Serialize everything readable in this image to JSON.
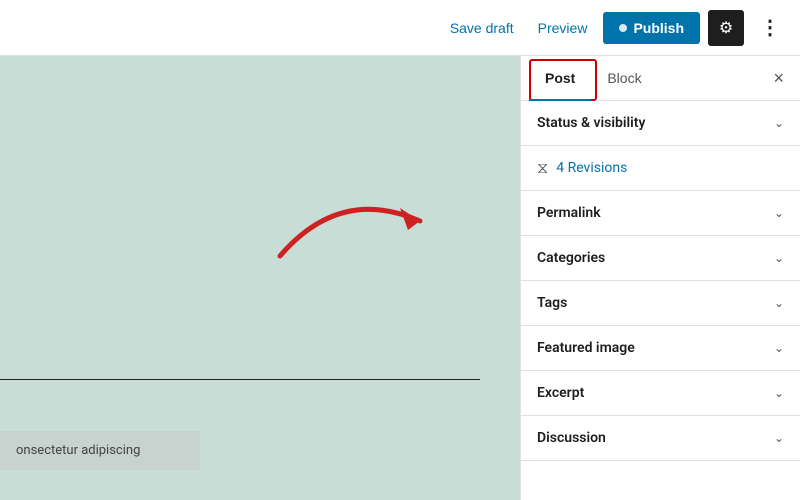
{
  "toolbar": {
    "save_draft_label": "Save draft",
    "preview_label": "Preview",
    "publish_label": "Publish",
    "settings_icon": "⚙",
    "more_icon": "⋮"
  },
  "sidebar": {
    "tab_post_label": "Post",
    "tab_block_label": "Block",
    "close_icon": "×",
    "sections": [
      {
        "id": "status-visibility",
        "label": "Status & visibility"
      },
      {
        "id": "permalink",
        "label": "Permalink"
      },
      {
        "id": "categories",
        "label": "Categories"
      },
      {
        "id": "tags",
        "label": "Tags"
      },
      {
        "id": "featured-image",
        "label": "Featured image"
      },
      {
        "id": "excerpt",
        "label": "Excerpt"
      },
      {
        "id": "discussion",
        "label": "Discussion"
      }
    ],
    "revisions_count": "4 Revisions"
  },
  "content": {
    "lorem_text": "onsectetur adipiscing"
  }
}
